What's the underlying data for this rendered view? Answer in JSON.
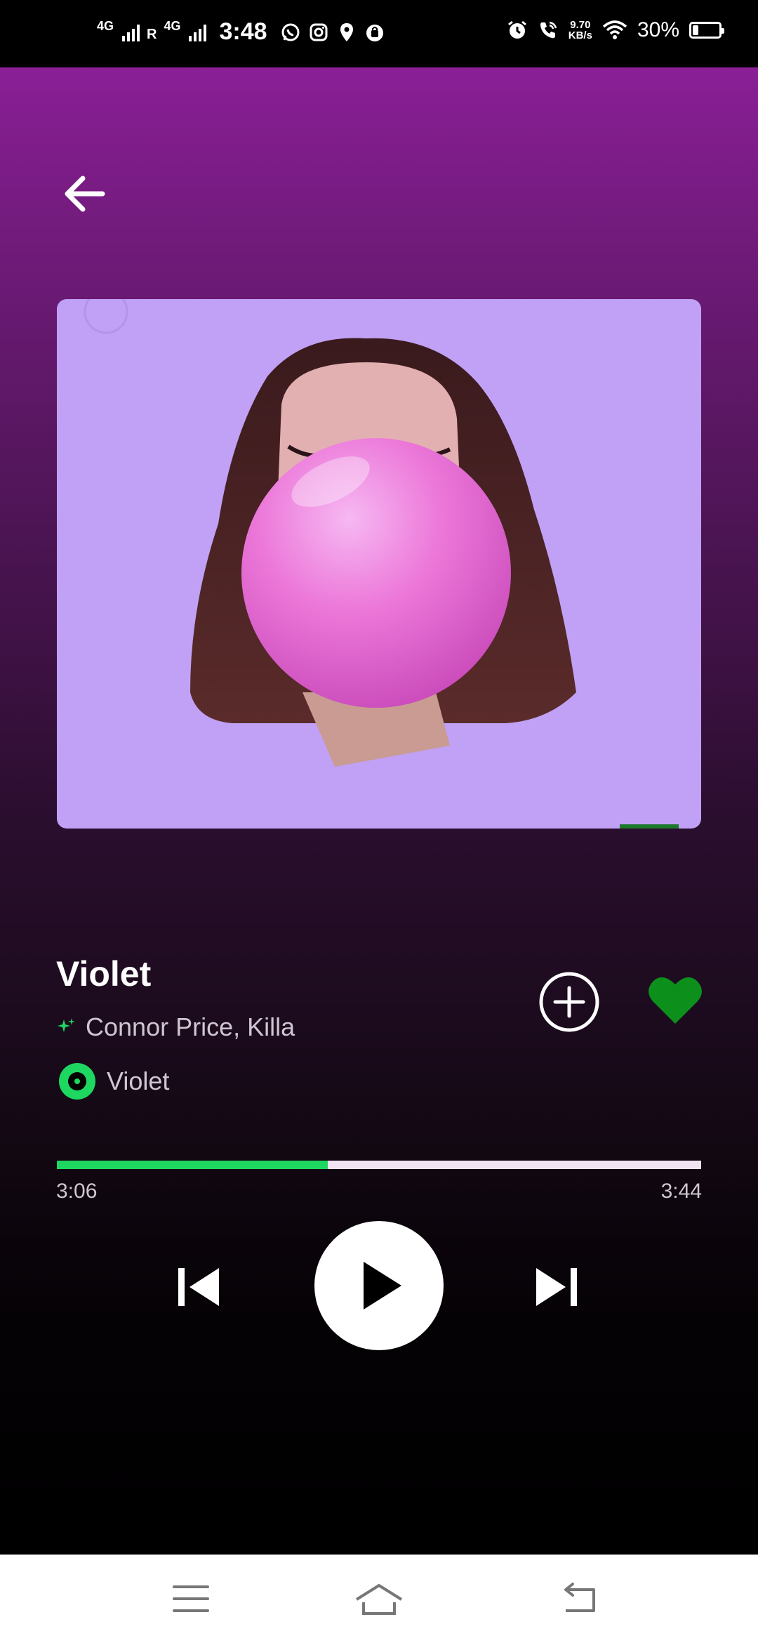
{
  "status_bar": {
    "network_1": "4G",
    "roaming": "R",
    "network_2": "4G",
    "time": "3:48",
    "app_icons": [
      "whatsapp-icon",
      "instagram-icon",
      "maps-pin-icon",
      "shopping-bag-icon"
    ],
    "status_icons": [
      "alarm-icon",
      "wifi-calling-icon"
    ],
    "speed_value": "9.70",
    "speed_unit": "KB/s",
    "battery_percent": "30%",
    "battery_level": 0.3
  },
  "player": {
    "back_icon": "arrow-left-icon",
    "album_art_desc": "girl-blowing-bubblegum-artwork",
    "track": {
      "title": "Violet",
      "artists": "Connor Price, Killa",
      "album": "Violet"
    },
    "progress": {
      "elapsed": "3:06",
      "duration": "3:44",
      "fraction": 0.42
    },
    "liked": true,
    "controls": [
      "skip-previous-icon",
      "play-icon",
      "skip-next-icon"
    ],
    "colors": {
      "accent_green": "#1ed760",
      "like_green": "#0d8f1c",
      "album_bg": "#c0a1f5",
      "gradient_top": "#8a1f96"
    }
  },
  "nav_bar": {
    "icons": [
      "menu-icon",
      "home-icon",
      "back-icon"
    ]
  }
}
